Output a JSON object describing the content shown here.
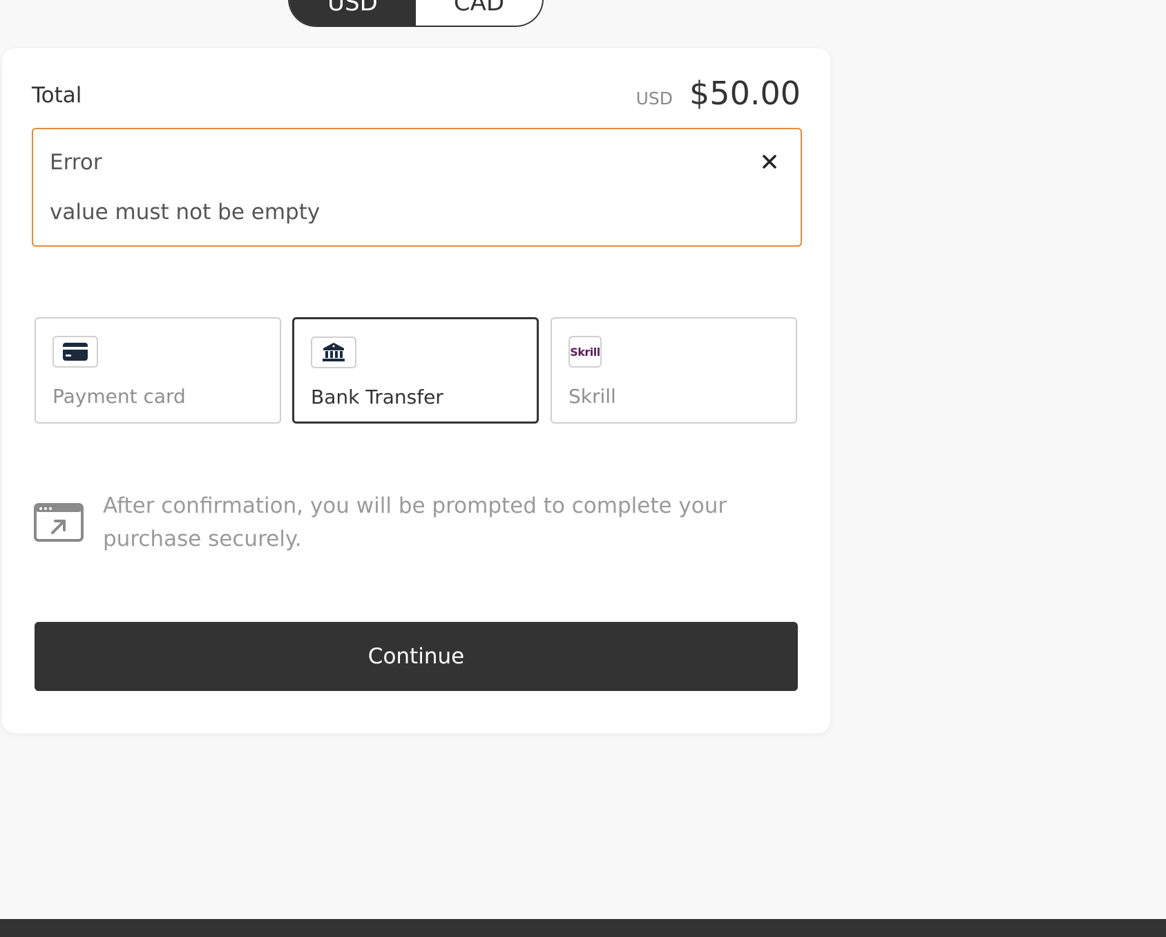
{
  "currency": {
    "options": [
      "USD",
      "CAD"
    ],
    "selected": "USD"
  },
  "summary": {
    "total_label": "Total",
    "currency_code": "USD",
    "amount": "$50.00"
  },
  "error": {
    "title": "Error",
    "message": "value must not be empty",
    "close_icon": "close-icon"
  },
  "payment_methods": [
    {
      "label": "Payment card",
      "icon": "credit-card-icon",
      "selected": false
    },
    {
      "label": "Bank Transfer",
      "icon": "bank-icon",
      "selected": true
    },
    {
      "label": "Skrill",
      "icon": "skrill-logo",
      "logo_text": "Skrill",
      "selected": false
    }
  ],
  "info": {
    "icon": "external-window-icon",
    "text": "After confirmation, you will be prompted to complete your purchase securely."
  },
  "actions": {
    "continue_label": "Continue"
  },
  "colors": {
    "primary": "#333333",
    "error_border": "#e38a3c",
    "icon_dark": "#1b2a3d",
    "skrill_brand": "#5b1f5f"
  }
}
